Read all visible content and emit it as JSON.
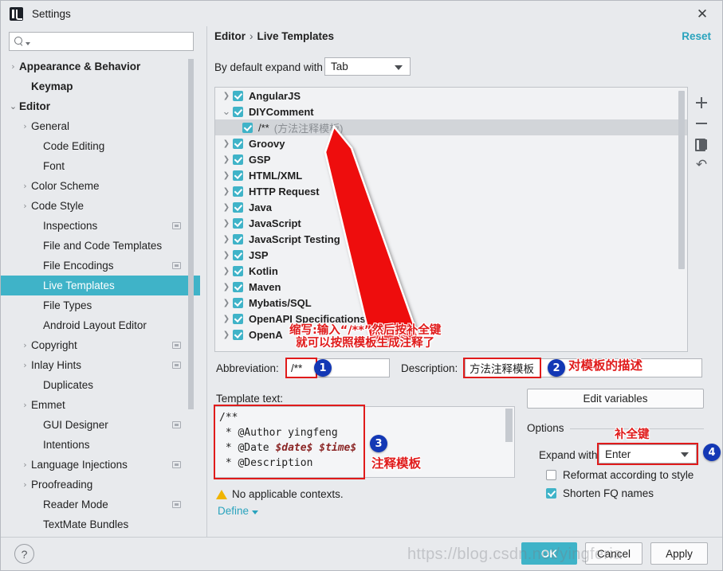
{
  "window": {
    "title": "Settings",
    "logo_icon": "intellij-idea-logo",
    "close_icon": "close-x-icon"
  },
  "search": {
    "placeholder": "",
    "value": "",
    "icon": "search-icon"
  },
  "sidebar": {
    "items": [
      {
        "label": "Appearance & Behavior",
        "chevron": "right",
        "bold": true,
        "indent": 0,
        "module_icon": false
      },
      {
        "label": "Keymap",
        "chevron": "none",
        "bold": true,
        "indent": 1,
        "module_icon": false
      },
      {
        "label": "Editor",
        "chevron": "down",
        "bold": true,
        "indent": 0,
        "module_icon": false
      },
      {
        "label": "General",
        "chevron": "right",
        "bold": false,
        "indent": 1,
        "module_icon": false
      },
      {
        "label": "Code Editing",
        "chevron": "none",
        "bold": false,
        "indent": 2,
        "module_icon": false
      },
      {
        "label": "Font",
        "chevron": "none",
        "bold": false,
        "indent": 2,
        "module_icon": false
      },
      {
        "label": "Color Scheme",
        "chevron": "right",
        "bold": false,
        "indent": 1,
        "module_icon": false
      },
      {
        "label": "Code Style",
        "chevron": "right",
        "bold": false,
        "indent": 1,
        "module_icon": false
      },
      {
        "label": "Inspections",
        "chevron": "none",
        "bold": false,
        "indent": 2,
        "module_icon": true
      },
      {
        "label": "File and Code Templates",
        "chevron": "none",
        "bold": false,
        "indent": 2,
        "module_icon": false
      },
      {
        "label": "File Encodings",
        "chevron": "none",
        "bold": false,
        "indent": 2,
        "module_icon": true
      },
      {
        "label": "Live Templates",
        "chevron": "none",
        "bold": false,
        "indent": 2,
        "module_icon": false,
        "selected": true
      },
      {
        "label": "File Types",
        "chevron": "none",
        "bold": false,
        "indent": 2,
        "module_icon": false
      },
      {
        "label": "Android Layout Editor",
        "chevron": "none",
        "bold": false,
        "indent": 2,
        "module_icon": false
      },
      {
        "label": "Copyright",
        "chevron": "right",
        "bold": false,
        "indent": 1,
        "module_icon": true
      },
      {
        "label": "Inlay Hints",
        "chevron": "right",
        "bold": false,
        "indent": 1,
        "module_icon": true
      },
      {
        "label": "Duplicates",
        "chevron": "none",
        "bold": false,
        "indent": 2,
        "module_icon": false
      },
      {
        "label": "Emmet",
        "chevron": "right",
        "bold": false,
        "indent": 1,
        "module_icon": false
      },
      {
        "label": "GUI Designer",
        "chevron": "none",
        "bold": false,
        "indent": 2,
        "module_icon": true
      },
      {
        "label": "Intentions",
        "chevron": "none",
        "bold": false,
        "indent": 2,
        "module_icon": false
      },
      {
        "label": "Language Injections",
        "chevron": "right",
        "bold": false,
        "indent": 1,
        "module_icon": true
      },
      {
        "label": "Proofreading",
        "chevron": "right",
        "bold": false,
        "indent": 1,
        "module_icon": false
      },
      {
        "label": "Reader Mode",
        "chevron": "none",
        "bold": false,
        "indent": 2,
        "module_icon": true
      },
      {
        "label": "TextMate Bundles",
        "chevron": "none",
        "bold": false,
        "indent": 2,
        "module_icon": false
      }
    ]
  },
  "header": {
    "breadcrumb_parent": "Editor",
    "breadcrumb_separator": "›",
    "breadcrumb_current": "Live Templates",
    "reset_label": "Reset"
  },
  "default_expand": {
    "label": "By default expand with",
    "value": "Tab"
  },
  "template_tree": {
    "rows": [
      {
        "chevron": "right",
        "label": "AngularJS",
        "checked": true,
        "child": false,
        "bold": true
      },
      {
        "chevron": "down",
        "label": "DIYComment",
        "checked": true,
        "child": false,
        "bold": true
      },
      {
        "chevron": "none",
        "label": "/**",
        "desc": "(方法注释模板)",
        "checked": true,
        "child": true,
        "bold": false,
        "selected": true
      },
      {
        "chevron": "right",
        "label": "Groovy",
        "checked": true,
        "child": false,
        "bold": true
      },
      {
        "chevron": "right",
        "label": "GSP",
        "checked": true,
        "child": false,
        "bold": true
      },
      {
        "chevron": "right",
        "label": "HTML/XML",
        "checked": true,
        "child": false,
        "bold": true
      },
      {
        "chevron": "right",
        "label": "HTTP Request",
        "checked": true,
        "child": false,
        "bold": true
      },
      {
        "chevron": "right",
        "label": "Java",
        "checked": true,
        "child": false,
        "bold": true
      },
      {
        "chevron": "right",
        "label": "JavaScript",
        "checked": true,
        "child": false,
        "bold": true
      },
      {
        "chevron": "right",
        "label": "JavaScript Testing",
        "checked": true,
        "child": false,
        "bold": true
      },
      {
        "chevron": "right",
        "label": "JSP",
        "checked": true,
        "child": false,
        "bold": true
      },
      {
        "chevron": "right",
        "label": "Kotlin",
        "checked": true,
        "child": false,
        "bold": true
      },
      {
        "chevron": "right",
        "label": "Maven",
        "checked": true,
        "child": false,
        "bold": true
      },
      {
        "chevron": "right",
        "label": "Mybatis/SQL",
        "checked": true,
        "child": false,
        "bold": true
      },
      {
        "chevron": "right",
        "label": "OpenAPI Specifications (.json)",
        "checked": true,
        "child": false,
        "bold": true
      },
      {
        "chevron": "right",
        "label": "OpenA",
        "checked": true,
        "child": false,
        "bold": true
      }
    ],
    "toolbar": [
      {
        "name": "add-template-button",
        "icon": "plus-icon"
      },
      {
        "name": "remove-template-button",
        "icon": "minus-icon"
      },
      {
        "name": "duplicate-template-button",
        "icon": "copy-icon"
      },
      {
        "name": "restore-defaults-button",
        "icon": "undo-arrow-icon"
      }
    ]
  },
  "fields": {
    "abbreviation_label": "Abbreviation:",
    "abbreviation_value": "/**",
    "description_label": "Description:",
    "description_value": "方法注释模板",
    "template_text_label": "Template text:",
    "template_code_line1": "/**",
    "template_code_line2_pre": " * @Author yingfeng",
    "template_code_line3_pre": " * @Date ",
    "template_code_line3_var1": "$date$",
    "template_code_line3_var2": "$time$",
    "template_code_line4": " * @Description",
    "warning_text": "No applicable contexts.",
    "warning_icon": "warning-triangle-icon",
    "define_link": "Define"
  },
  "options": {
    "edit_variables_label": "Edit variables",
    "title": "Options",
    "expand_with_label": "Expand with",
    "expand_with_value": "Enter",
    "reformat_label": "Reformat according to style",
    "reformat_checked": false,
    "shorten_label": "Shorten FQ names",
    "shorten_checked": true
  },
  "footer": {
    "help_label": "?",
    "ok_label": "OK",
    "cancel_label": "Cancel",
    "apply_label": "Apply",
    "watermark": "https://blog.csdn.net/yingferia"
  },
  "annotations": {
    "badge1": "1",
    "badge2": "2",
    "badge3": "3",
    "badge4": "4",
    "note_arrow_line1": "缩写:输入“/**”然后按补全键",
    "note_arrow_line2": "就可以按照模板生成注释了",
    "note_description": "对模板的描述",
    "note_code": "注释模板",
    "note_expand": "补全键"
  },
  "colors": {
    "accent_teal": "#3fb3c8",
    "annotation_red": "#e01b1b",
    "badge_blue": "#1338b5",
    "link_blue": "#29a3bd",
    "window_bg": "#e8eaed"
  }
}
